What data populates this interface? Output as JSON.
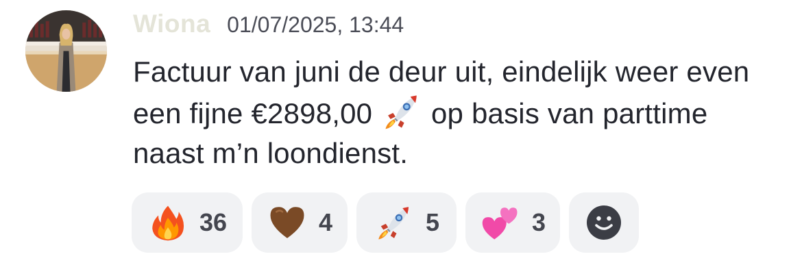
{
  "message": {
    "author": "Wiona",
    "timestamp": "01/07/2025, 13:44",
    "text_part1": "Factuur van juni de deur uit, eindelijk weer even een fijne €2898,00",
    "inline_emoji": "rocket-icon",
    "text_part2": "op basis van parttime naast m’n loondienst."
  },
  "reactions": [
    {
      "emoji": "fire-icon",
      "count": "36"
    },
    {
      "emoji": "brown-heart-icon",
      "count": "4"
    },
    {
      "emoji": "rocket-icon",
      "count": "5"
    },
    {
      "emoji": "two-hearts-icon",
      "count": "3"
    }
  ],
  "add_reaction": {
    "icon": "smiley-add-reaction-icon"
  },
  "colors": {
    "author": "#e4e4d8",
    "timestamp": "#4b4d57",
    "body_text": "#23252d",
    "reaction_bg": "#f1f2f4",
    "reaction_count": "#44464f"
  }
}
